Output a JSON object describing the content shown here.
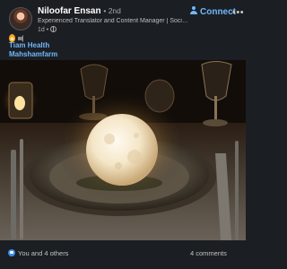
{
  "post": {
    "author": {
      "name": "Niloofar Ensan",
      "degree": "• 2nd",
      "headline": "Experienced Translator and Content Manager | Social Sci...",
      "time": "1d •"
    },
    "connect_label": "Connect",
    "more_label": "•••",
    "hashtags": [
      "Tiam Health",
      "Mahshamfarm"
    ],
    "image_icon": "moon-lamp-photo",
    "reactions_label": "You and 4 others",
    "comments_label": "4 comments"
  },
  "colors": {
    "background": "#1b1f23",
    "link": "#71b7fb",
    "like": "#378fe9"
  },
  "icons": {
    "avatar": "avatar",
    "connect": "person-add-icon",
    "more": "more-icon",
    "visibility": "globe-icon",
    "like": "like-icon"
  }
}
